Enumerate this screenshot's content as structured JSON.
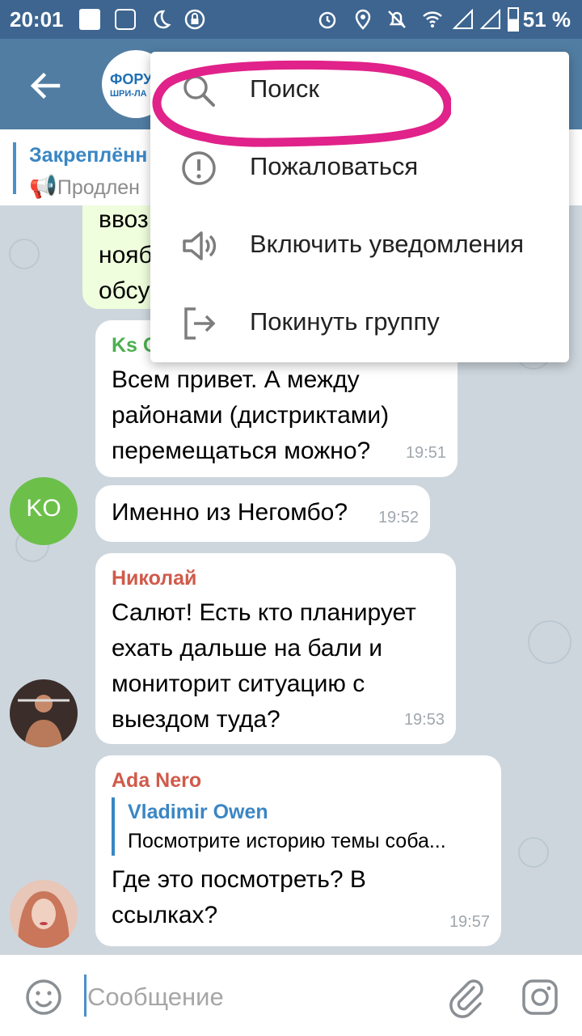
{
  "status_bar": {
    "time": "20:01",
    "battery": "51 %"
  },
  "header": {
    "logo_line1": "ФОРУ",
    "logo_line2": "ШРИ-ЛА"
  },
  "pinned": {
    "title": "Закреплённ",
    "preview": "Продлен"
  },
  "messages": [
    {
      "text_lines": [
        "ввоз",
        "нояб",
        "обсу"
      ]
    },
    {
      "sender": "Ks O",
      "sender_color": "#4caf50",
      "text": "Всем привет. А между районами (дистриктами) перемещаться можно?",
      "time": "19:51"
    },
    {
      "text": "Именно из Негомбо?",
      "time": "19:52",
      "avatar_initials": "KO",
      "avatar_color": "#6cc04a"
    },
    {
      "sender": "Николай",
      "sender_color": "#d05a4a",
      "text": "Салют! Есть кто планирует ехать дальше на бали и мониторит ситуацию с выездом туда?",
      "time": "19:53"
    },
    {
      "sender": "Ada Nero",
      "sender_color": "#d05a4a",
      "reply_name": "Vladimir Owen",
      "reply_text": "Посмотрите историю темы соба...",
      "text": "Где это посмотреть? В ссылках?",
      "time": "19:57"
    }
  ],
  "input": {
    "placeholder": "Сообщение"
  },
  "menu": {
    "items": [
      {
        "label": "Поиск",
        "icon": "search-icon"
      },
      {
        "label": "Пожаловаться",
        "icon": "report-icon"
      },
      {
        "label": "Включить уведомления",
        "icon": "speaker-icon"
      },
      {
        "label": "Покинуть группу",
        "icon": "leave-icon"
      }
    ]
  },
  "colors": {
    "header": "#517da2",
    "status_bar": "#3d6590",
    "highlight": "#e0228a",
    "accent": "#3a86c4"
  }
}
